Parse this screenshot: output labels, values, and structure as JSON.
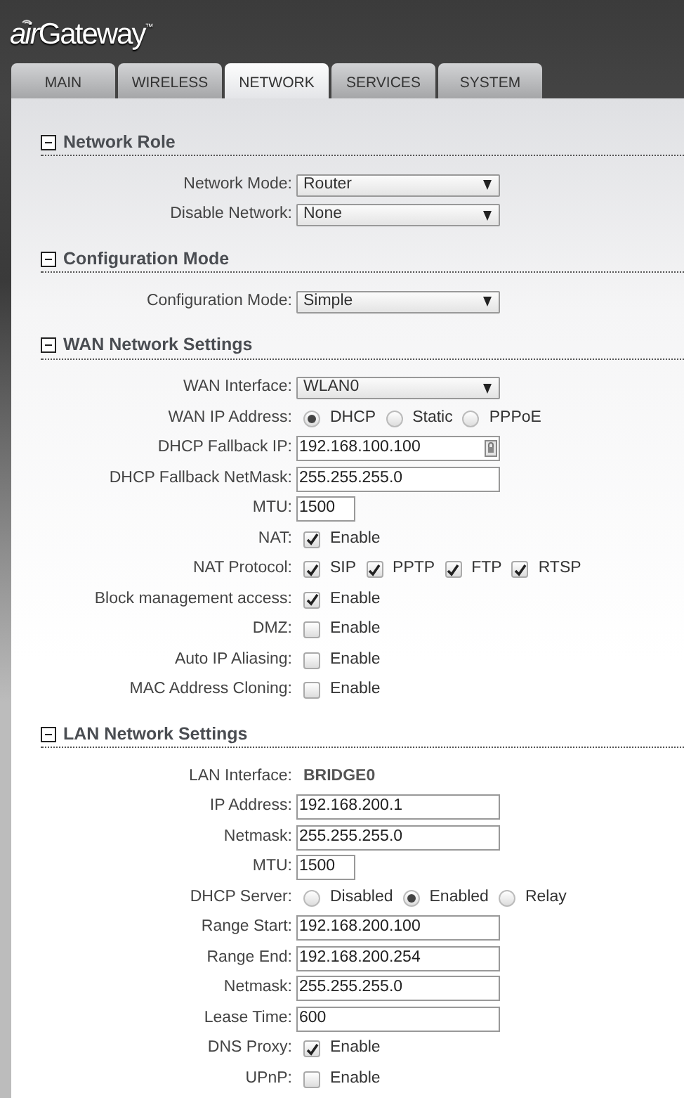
{
  "header": {
    "logo_prefix": "air",
    "logo_name": "Gateway",
    "logo_mark": "™"
  },
  "tabs": [
    {
      "label": "MAIN",
      "selected": false
    },
    {
      "label": "WIRELESS",
      "selected": false
    },
    {
      "label": "NETWORK",
      "selected": true
    },
    {
      "label": "SERVICES",
      "selected": false
    },
    {
      "label": "SYSTEM",
      "selected": false
    }
  ],
  "sections": [
    {
      "title": "Network Role",
      "rows": [
        {
          "kind": "select",
          "label": "Network Mode:",
          "value": "Router"
        },
        {
          "kind": "select",
          "label": "Disable Network:",
          "value": "None"
        }
      ]
    },
    {
      "title": "Configuration Mode",
      "rows": [
        {
          "kind": "select",
          "label": "Configuration Mode:",
          "value": "Simple"
        }
      ]
    },
    {
      "title": "WAN Network Settings",
      "rows": [
        {
          "kind": "select",
          "label": "WAN Interface:",
          "value": "WLAN0"
        },
        {
          "kind": "radio",
          "label": "WAN IP Address:",
          "options": [
            {
              "label": "DHCP",
              "selected": true
            },
            {
              "label": "Static",
              "selected": false
            },
            {
              "label": "PPPoE",
              "selected": false
            }
          ]
        },
        {
          "kind": "text",
          "label": "DHCP Fallback IP:",
          "value": "192.168.100.100",
          "lock_button": true
        },
        {
          "kind": "text",
          "label": "DHCP Fallback NetMask:",
          "value": "255.255.255.0"
        },
        {
          "kind": "short",
          "label": "MTU:",
          "value": "1500"
        },
        {
          "kind": "check",
          "label": "NAT:",
          "options": [
            {
              "label": "Enable",
              "checked": true
            }
          ]
        },
        {
          "kind": "check",
          "label": "NAT Protocol:",
          "options": [
            {
              "label": "SIP",
              "checked": true
            },
            {
              "label": "PPTP",
              "checked": true
            },
            {
              "label": "FTP",
              "checked": true
            },
            {
              "label": "RTSP",
              "checked": true
            }
          ]
        },
        {
          "kind": "check",
          "label": "Block management access:",
          "options": [
            {
              "label": "Enable",
              "checked": true
            }
          ]
        },
        {
          "kind": "check",
          "label": "DMZ:",
          "options": [
            {
              "label": "Enable",
              "checked": false
            }
          ]
        },
        {
          "kind": "check",
          "label": "Auto IP Aliasing:",
          "options": [
            {
              "label": "Enable",
              "checked": false
            }
          ]
        },
        {
          "kind": "check",
          "label": "MAC Address Cloning:",
          "options": [
            {
              "label": "Enable",
              "checked": false
            }
          ]
        }
      ]
    },
    {
      "title": "LAN Network Settings",
      "rows": [
        {
          "kind": "static",
          "label": "LAN Interface:",
          "value": "BRIDGE0"
        },
        {
          "kind": "text",
          "label": "IP Address:",
          "value": "192.168.200.1"
        },
        {
          "kind": "text",
          "label": "Netmask:",
          "value": "255.255.255.0"
        },
        {
          "kind": "short",
          "label": "MTU:",
          "value": "1500"
        },
        {
          "kind": "radio",
          "label": "DHCP Server:",
          "options": [
            {
              "label": "Disabled",
              "selected": false
            },
            {
              "label": "Enabled",
              "selected": true
            },
            {
              "label": "Relay",
              "selected": false
            }
          ]
        },
        {
          "kind": "text",
          "label": "Range Start:",
          "value": "192.168.200.100"
        },
        {
          "kind": "text",
          "label": "Range End:",
          "value": "192.168.200.254"
        },
        {
          "kind": "text",
          "label": "Netmask:",
          "value": "255.255.255.0"
        },
        {
          "kind": "text",
          "label": "Lease Time:",
          "value": "600"
        },
        {
          "kind": "check",
          "label": "DNS Proxy:",
          "options": [
            {
              "label": "Enable",
              "checked": true
            }
          ]
        },
        {
          "kind": "check",
          "label": "UPnP:",
          "options": [
            {
              "label": "Enable",
              "checked": false
            }
          ]
        }
      ]
    }
  ]
}
